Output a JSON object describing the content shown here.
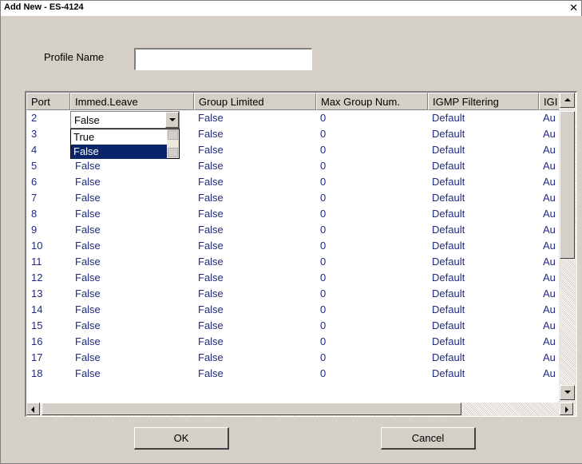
{
  "window": {
    "title": "Add New - ES-4124",
    "close_label": "✕"
  },
  "form": {
    "profile_name_label": "Profile Name",
    "profile_name_value": ""
  },
  "table": {
    "columns": [
      "Port",
      "Immed.Leave",
      "Group Limited",
      "Max Group Num.",
      "IGMP Filtering",
      "IGI"
    ],
    "rows": [
      {
        "port": "2",
        "immed": "False",
        "group": "False",
        "max": "0",
        "filter": "Default",
        "igmp": "Au"
      },
      {
        "port": "3",
        "immed": "False",
        "group": "False",
        "max": "0",
        "filter": "Default",
        "igmp": "Au"
      },
      {
        "port": "4",
        "immed": "False",
        "group": "False",
        "max": "0",
        "filter": "Default",
        "igmp": "Au"
      },
      {
        "port": "5",
        "immed": "False",
        "group": "False",
        "max": "0",
        "filter": "Default",
        "igmp": "Au"
      },
      {
        "port": "6",
        "immed": "False",
        "group": "False",
        "max": "0",
        "filter": "Default",
        "igmp": "Au"
      },
      {
        "port": "7",
        "immed": "False",
        "group": "False",
        "max": "0",
        "filter": "Default",
        "igmp": "Au"
      },
      {
        "port": "8",
        "immed": "False",
        "group": "False",
        "max": "0",
        "filter": "Default",
        "igmp": "Au"
      },
      {
        "port": "9",
        "immed": "False",
        "group": "False",
        "max": "0",
        "filter": "Default",
        "igmp": "Au"
      },
      {
        "port": "10",
        "immed": "False",
        "group": "False",
        "max": "0",
        "filter": "Default",
        "igmp": "Au"
      },
      {
        "port": "11",
        "immed": "False",
        "group": "False",
        "max": "0",
        "filter": "Default",
        "igmp": "Au"
      },
      {
        "port": "12",
        "immed": "False",
        "group": "False",
        "max": "0",
        "filter": "Default",
        "igmp": "Au"
      },
      {
        "port": "13",
        "immed": "False",
        "group": "False",
        "max": "0",
        "filter": "Default",
        "igmp": "Au"
      },
      {
        "port": "14",
        "immed": "False",
        "group": "False",
        "max": "0",
        "filter": "Default",
        "igmp": "Au"
      },
      {
        "port": "15",
        "immed": "False",
        "group": "False",
        "max": "0",
        "filter": "Default",
        "igmp": "Au"
      },
      {
        "port": "16",
        "immed": "False",
        "group": "False",
        "max": "0",
        "filter": "Default",
        "igmp": "Au"
      },
      {
        "port": "17",
        "immed": "False",
        "group": "False",
        "max": "0",
        "filter": "Default",
        "igmp": "Au"
      },
      {
        "port": "18",
        "immed": "False",
        "group": "False",
        "max": "0",
        "filter": "Default",
        "igmp": "Au"
      }
    ],
    "dropdown": {
      "selected": "False",
      "options": [
        "True",
        "False"
      ],
      "highlighted": "False"
    }
  },
  "buttons": {
    "ok": "OK",
    "cancel": "Cancel"
  }
}
